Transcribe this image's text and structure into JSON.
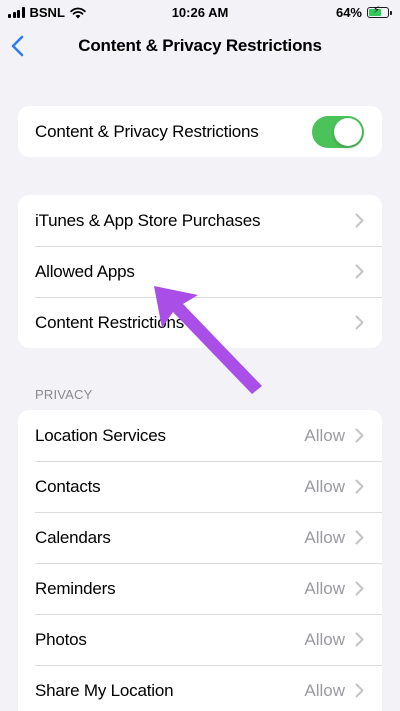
{
  "status_bar": {
    "carrier": "BSNL",
    "time": "10:26 AM",
    "battery": "64%",
    "battery_level": 0.64,
    "battery_color": "#34c759"
  },
  "nav": {
    "back_icon": "chevron-left-icon",
    "title": "Content & Privacy Restrictions"
  },
  "main_toggle": {
    "label": "Content & Privacy Restrictions",
    "on": true,
    "color": "#4cc35a"
  },
  "store_group": [
    {
      "label": "iTunes & App Store Purchases"
    },
    {
      "label": "Allowed Apps"
    },
    {
      "label": "Content Restrictions"
    }
  ],
  "privacy": {
    "header": "PRIVACY",
    "items": [
      {
        "label": "Location Services",
        "value": "Allow"
      },
      {
        "label": "Contacts",
        "value": "Allow"
      },
      {
        "label": "Calendars",
        "value": "Allow"
      },
      {
        "label": "Reminders",
        "value": "Allow"
      },
      {
        "label": "Photos",
        "value": "Allow"
      },
      {
        "label": "Share My Location",
        "value": "Allow"
      }
    ]
  },
  "annotation": {
    "arrow_color": "#a94ee6",
    "arrow_icon": "pointer-arrow-icon"
  },
  "colors": {
    "accent": "#2f7bf5",
    "background": "#f2f2f7"
  }
}
